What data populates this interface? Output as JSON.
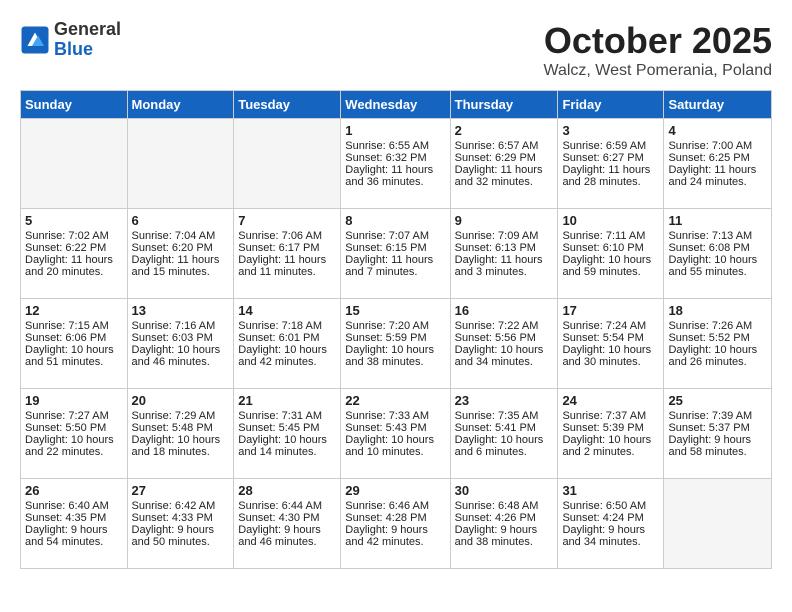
{
  "header": {
    "logo_general": "General",
    "logo_blue": "Blue",
    "month_title": "October 2025",
    "location": "Walcz, West Pomerania, Poland"
  },
  "days_of_week": [
    "Sunday",
    "Monday",
    "Tuesday",
    "Wednesday",
    "Thursday",
    "Friday",
    "Saturday"
  ],
  "weeks": [
    [
      {
        "day": "",
        "empty": true
      },
      {
        "day": "",
        "empty": true
      },
      {
        "day": "",
        "empty": true
      },
      {
        "day": "1",
        "sunrise": "Sunrise: 6:55 AM",
        "sunset": "Sunset: 6:32 PM",
        "daylight": "Daylight: 11 hours and 36 minutes."
      },
      {
        "day": "2",
        "sunrise": "Sunrise: 6:57 AM",
        "sunset": "Sunset: 6:29 PM",
        "daylight": "Daylight: 11 hours and 32 minutes."
      },
      {
        "day": "3",
        "sunrise": "Sunrise: 6:59 AM",
        "sunset": "Sunset: 6:27 PM",
        "daylight": "Daylight: 11 hours and 28 minutes."
      },
      {
        "day": "4",
        "sunrise": "Sunrise: 7:00 AM",
        "sunset": "Sunset: 6:25 PM",
        "daylight": "Daylight: 11 hours and 24 minutes."
      }
    ],
    [
      {
        "day": "5",
        "sunrise": "Sunrise: 7:02 AM",
        "sunset": "Sunset: 6:22 PM",
        "daylight": "Daylight: 11 hours and 20 minutes."
      },
      {
        "day": "6",
        "sunrise": "Sunrise: 7:04 AM",
        "sunset": "Sunset: 6:20 PM",
        "daylight": "Daylight: 11 hours and 15 minutes."
      },
      {
        "day": "7",
        "sunrise": "Sunrise: 7:06 AM",
        "sunset": "Sunset: 6:17 PM",
        "daylight": "Daylight: 11 hours and 11 minutes."
      },
      {
        "day": "8",
        "sunrise": "Sunrise: 7:07 AM",
        "sunset": "Sunset: 6:15 PM",
        "daylight": "Daylight: 11 hours and 7 minutes."
      },
      {
        "day": "9",
        "sunrise": "Sunrise: 7:09 AM",
        "sunset": "Sunset: 6:13 PM",
        "daylight": "Daylight: 11 hours and 3 minutes."
      },
      {
        "day": "10",
        "sunrise": "Sunrise: 7:11 AM",
        "sunset": "Sunset: 6:10 PM",
        "daylight": "Daylight: 10 hours and 59 minutes."
      },
      {
        "day": "11",
        "sunrise": "Sunrise: 7:13 AM",
        "sunset": "Sunset: 6:08 PM",
        "daylight": "Daylight: 10 hours and 55 minutes."
      }
    ],
    [
      {
        "day": "12",
        "sunrise": "Sunrise: 7:15 AM",
        "sunset": "Sunset: 6:06 PM",
        "daylight": "Daylight: 10 hours and 51 minutes."
      },
      {
        "day": "13",
        "sunrise": "Sunrise: 7:16 AM",
        "sunset": "Sunset: 6:03 PM",
        "daylight": "Daylight: 10 hours and 46 minutes."
      },
      {
        "day": "14",
        "sunrise": "Sunrise: 7:18 AM",
        "sunset": "Sunset: 6:01 PM",
        "daylight": "Daylight: 10 hours and 42 minutes."
      },
      {
        "day": "15",
        "sunrise": "Sunrise: 7:20 AM",
        "sunset": "Sunset: 5:59 PM",
        "daylight": "Daylight: 10 hours and 38 minutes."
      },
      {
        "day": "16",
        "sunrise": "Sunrise: 7:22 AM",
        "sunset": "Sunset: 5:56 PM",
        "daylight": "Daylight: 10 hours and 34 minutes."
      },
      {
        "day": "17",
        "sunrise": "Sunrise: 7:24 AM",
        "sunset": "Sunset: 5:54 PM",
        "daylight": "Daylight: 10 hours and 30 minutes."
      },
      {
        "day": "18",
        "sunrise": "Sunrise: 7:26 AM",
        "sunset": "Sunset: 5:52 PM",
        "daylight": "Daylight: 10 hours and 26 minutes."
      }
    ],
    [
      {
        "day": "19",
        "sunrise": "Sunrise: 7:27 AM",
        "sunset": "Sunset: 5:50 PM",
        "daylight": "Daylight: 10 hours and 22 minutes."
      },
      {
        "day": "20",
        "sunrise": "Sunrise: 7:29 AM",
        "sunset": "Sunset: 5:48 PM",
        "daylight": "Daylight: 10 hours and 18 minutes."
      },
      {
        "day": "21",
        "sunrise": "Sunrise: 7:31 AM",
        "sunset": "Sunset: 5:45 PM",
        "daylight": "Daylight: 10 hours and 14 minutes."
      },
      {
        "day": "22",
        "sunrise": "Sunrise: 7:33 AM",
        "sunset": "Sunset: 5:43 PM",
        "daylight": "Daylight: 10 hours and 10 minutes."
      },
      {
        "day": "23",
        "sunrise": "Sunrise: 7:35 AM",
        "sunset": "Sunset: 5:41 PM",
        "daylight": "Daylight: 10 hours and 6 minutes."
      },
      {
        "day": "24",
        "sunrise": "Sunrise: 7:37 AM",
        "sunset": "Sunset: 5:39 PM",
        "daylight": "Daylight: 10 hours and 2 minutes."
      },
      {
        "day": "25",
        "sunrise": "Sunrise: 7:39 AM",
        "sunset": "Sunset: 5:37 PM",
        "daylight": "Daylight: 9 hours and 58 minutes."
      }
    ],
    [
      {
        "day": "26",
        "sunrise": "Sunrise: 6:40 AM",
        "sunset": "Sunset: 4:35 PM",
        "daylight": "Daylight: 9 hours and 54 minutes."
      },
      {
        "day": "27",
        "sunrise": "Sunrise: 6:42 AM",
        "sunset": "Sunset: 4:33 PM",
        "daylight": "Daylight: 9 hours and 50 minutes."
      },
      {
        "day": "28",
        "sunrise": "Sunrise: 6:44 AM",
        "sunset": "Sunset: 4:30 PM",
        "daylight": "Daylight: 9 hours and 46 minutes."
      },
      {
        "day": "29",
        "sunrise": "Sunrise: 6:46 AM",
        "sunset": "Sunset: 4:28 PM",
        "daylight": "Daylight: 9 hours and 42 minutes."
      },
      {
        "day": "30",
        "sunrise": "Sunrise: 6:48 AM",
        "sunset": "Sunset: 4:26 PM",
        "daylight": "Daylight: 9 hours and 38 minutes."
      },
      {
        "day": "31",
        "sunrise": "Sunrise: 6:50 AM",
        "sunset": "Sunset: 4:24 PM",
        "daylight": "Daylight: 9 hours and 34 minutes."
      },
      {
        "day": "",
        "empty": true
      }
    ]
  ]
}
